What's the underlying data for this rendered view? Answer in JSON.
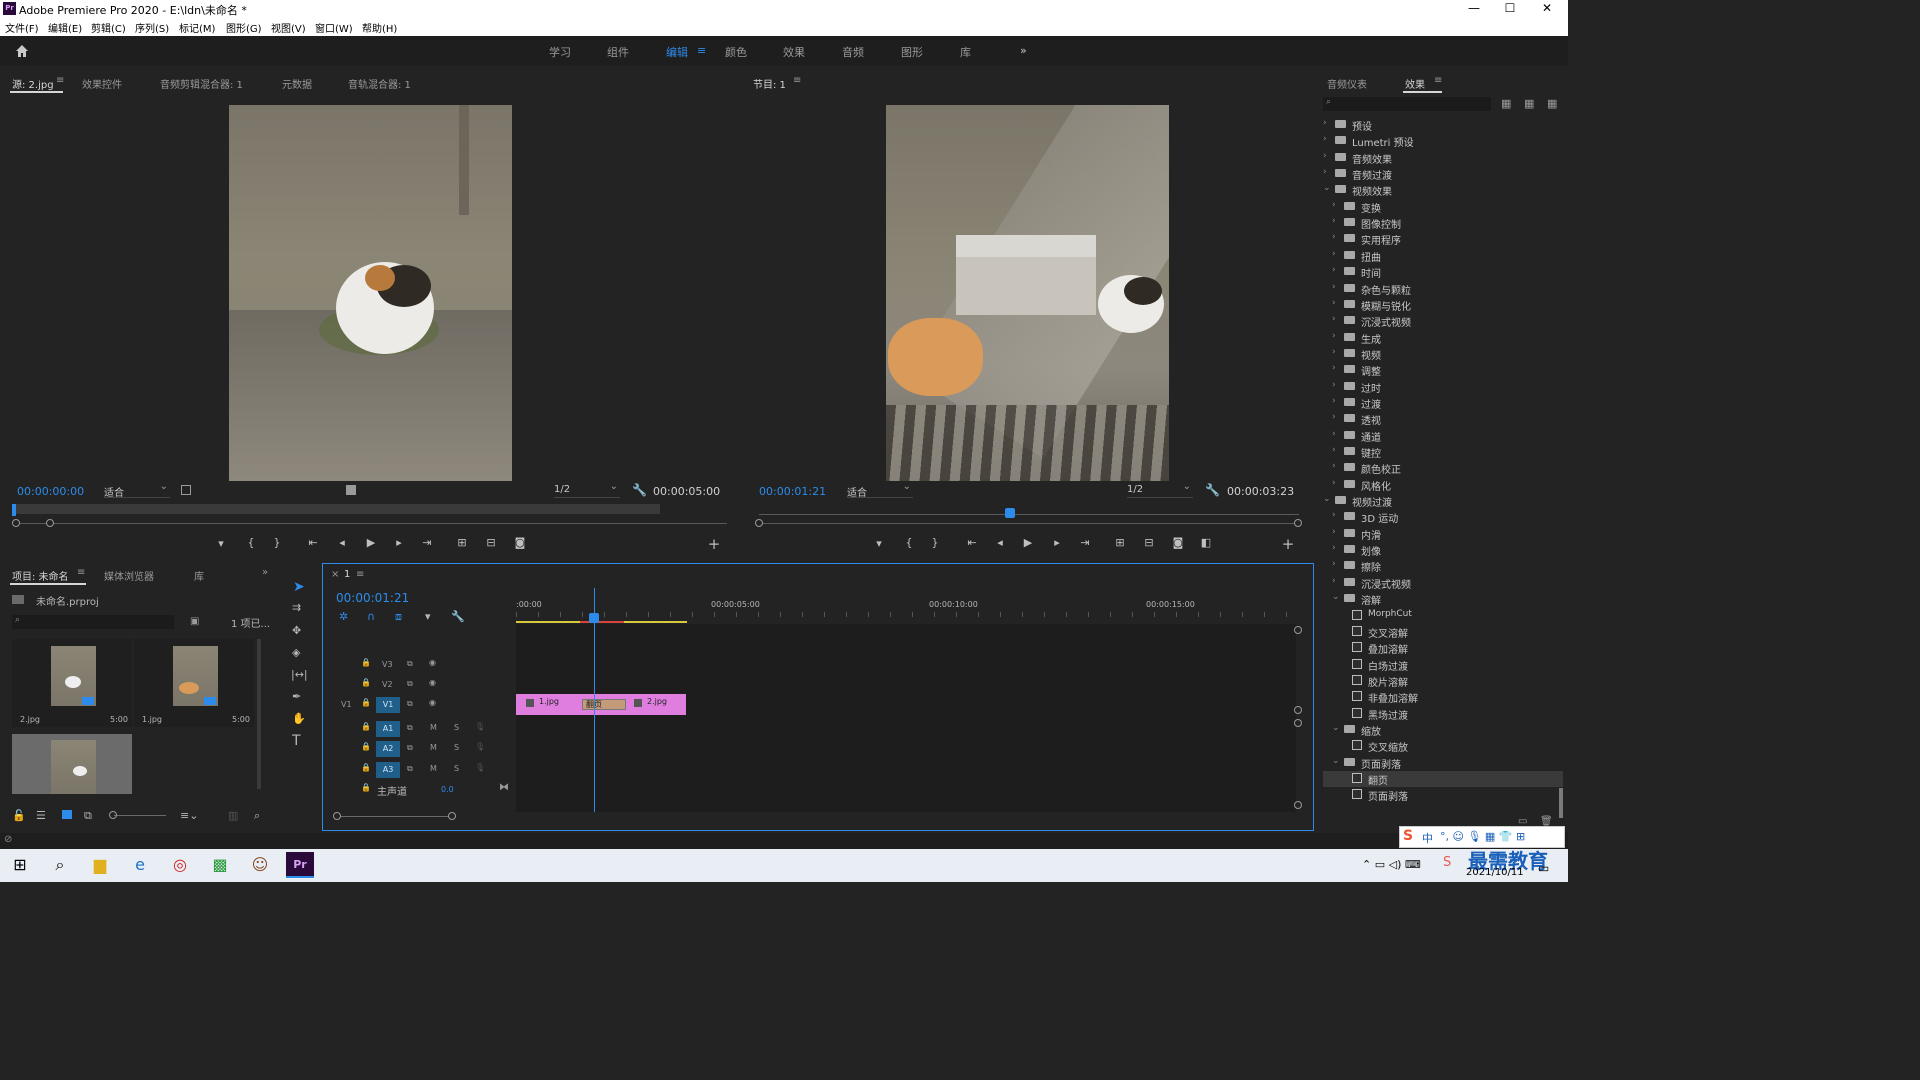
{
  "window": {
    "title": "Adobe Premiere Pro 2020 - E:\\ldn\\未命名 *",
    "logo": "Pr",
    "min": "—",
    "max": "☐",
    "close": "✕"
  },
  "menu": [
    "文件(F)",
    "编辑(E)",
    "剪辑(C)",
    "序列(S)",
    "标记(M)",
    "图形(G)",
    "视图(V)",
    "窗口(W)",
    "帮助(H)"
  ],
  "workspaces": [
    "学习",
    "组件",
    "编辑",
    "颜色",
    "效果",
    "音频",
    "图形",
    "库"
  ],
  "active_workspace": "编辑",
  "source_panel": {
    "tabs": [
      "源: 2.jpg",
      "效果控件",
      "音频剪辑混合器: 1",
      "元数据",
      "音轨混合器: 1"
    ],
    "timecode": "00:00:00:00",
    "fit": "适合",
    "resolution": "1/2",
    "duration": "00:00:05:00"
  },
  "program_panel": {
    "title": "节目: 1",
    "timecode": "00:00:01:21",
    "fit": "适合",
    "resolution": "1/2",
    "duration": "00:00:03:23"
  },
  "project_panel": {
    "tabs": [
      "项目: 未命名",
      "媒体浏览器",
      "库"
    ],
    "file": "未命名.prproj",
    "count": "1 项已...",
    "items": [
      {
        "name": "2.jpg",
        "dur": "5:00"
      },
      {
        "name": "1.jpg",
        "dur": "5:00"
      }
    ]
  },
  "timeline": {
    "tab": "1",
    "timecode": "00:00:01:21",
    "ruler": [
      ":00:00",
      "00:00:05:00",
      "00:00:10:00",
      "00:00:15:00"
    ],
    "video_tracks": [
      "V3",
      "V2",
      "V1"
    ],
    "audio_tracks": [
      "A1",
      "A2",
      "A3"
    ],
    "source_label": "V1",
    "master_label": "主声道",
    "master_value": "0.0",
    "clips": [
      {
        "name": "1.jpg"
      },
      {
        "name": "2.jpg"
      }
    ],
    "transition": "翻页"
  },
  "effects_panel": {
    "tabs": [
      "音频仪表",
      "效果"
    ],
    "tree": [
      {
        "d": 0,
        "t": "预设",
        "o": false
      },
      {
        "d": 0,
        "t": "Lumetri 预设",
        "o": false
      },
      {
        "d": 0,
        "t": "音频效果",
        "o": false
      },
      {
        "d": 0,
        "t": "音频过渡",
        "o": false
      },
      {
        "d": 0,
        "t": "视频效果",
        "o": true
      },
      {
        "d": 1,
        "t": "变换",
        "o": false
      },
      {
        "d": 1,
        "t": "图像控制",
        "o": false
      },
      {
        "d": 1,
        "t": "实用程序",
        "o": false
      },
      {
        "d": 1,
        "t": "扭曲",
        "o": false
      },
      {
        "d": 1,
        "t": "时间",
        "o": false
      },
      {
        "d": 1,
        "t": "杂色与颗粒",
        "o": false
      },
      {
        "d": 1,
        "t": "模糊与锐化",
        "o": false
      },
      {
        "d": 1,
        "t": "沉浸式视频",
        "o": false
      },
      {
        "d": 1,
        "t": "生成",
        "o": false
      },
      {
        "d": 1,
        "t": "视频",
        "o": false
      },
      {
        "d": 1,
        "t": "调整",
        "o": false
      },
      {
        "d": 1,
        "t": "过时",
        "o": false
      },
      {
        "d": 1,
        "t": "过渡",
        "o": false
      },
      {
        "d": 1,
        "t": "透视",
        "o": false
      },
      {
        "d": 1,
        "t": "通道",
        "o": false
      },
      {
        "d": 1,
        "t": "键控",
        "o": false
      },
      {
        "d": 1,
        "t": "颜色校正",
        "o": false
      },
      {
        "d": 1,
        "t": "风格化",
        "o": false
      },
      {
        "d": 0,
        "t": "视频过渡",
        "o": true
      },
      {
        "d": 1,
        "t": "3D 运动",
        "o": false
      },
      {
        "d": 1,
        "t": "内滑",
        "o": false
      },
      {
        "d": 1,
        "t": "划像",
        "o": false
      },
      {
        "d": 1,
        "t": "擦除",
        "o": false
      },
      {
        "d": 1,
        "t": "沉浸式视频",
        "o": false
      },
      {
        "d": 1,
        "t": "溶解",
        "o": true
      },
      {
        "d": 2,
        "t": "MorphCut"
      },
      {
        "d": 2,
        "t": "交叉溶解"
      },
      {
        "d": 2,
        "t": "叠加溶解"
      },
      {
        "d": 2,
        "t": "白场过渡"
      },
      {
        "d": 2,
        "t": "胶片溶解"
      },
      {
        "d": 2,
        "t": "非叠加溶解"
      },
      {
        "d": 2,
        "t": "黑场过渡"
      },
      {
        "d": 1,
        "t": "缩放",
        "o": true
      },
      {
        "d": 2,
        "t": "交叉缩放"
      },
      {
        "d": 1,
        "t": "页面剥落",
        "o": true
      },
      {
        "d": 2,
        "t": "翻页",
        "sel": true
      },
      {
        "d": 2,
        "t": "页面剥落"
      }
    ]
  },
  "taskbar": {
    "date": "2021/10/11",
    "watermark": "最需教育",
    "ime": "中"
  },
  "colors": {
    "accent": "#2d8ceb",
    "clip": "#e07ee0",
    "playhead": "#2d8ceb"
  }
}
